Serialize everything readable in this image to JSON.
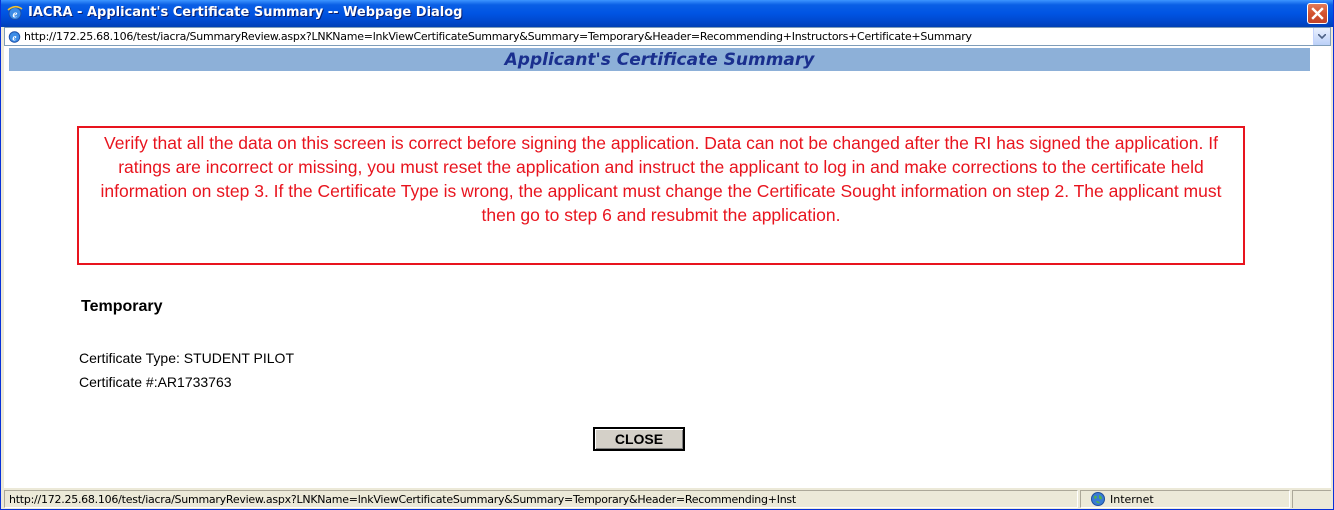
{
  "window": {
    "title": "IACRA - Applicant's Certificate Summary -- Webpage Dialog",
    "close_icon": "close-icon",
    "app_icon": "ie-icon"
  },
  "address": {
    "url": "http://172.25.68.106/test/iacra/SummaryReview.aspx?LNKName=lnkViewCertificateSummary&Summary=Temporary&Header=Recommending+Instructors+Certificate+Summary"
  },
  "page": {
    "title": "Applicant's Certificate Summary",
    "warning": "Verify that all the data on this screen is correct before signing the application. Data can not be changed after the RI has signed the application. If ratings are incorrect or missing, you must reset the application and instruct the applicant to log in and make corrections to the certificate held information on step 3. If the Certificate Type is wrong, the applicant must change the Certificate Sought information on step 2. The applicant must then go to step 6 and resubmit the application.",
    "section_heading": "Temporary",
    "certificate_type_line": "Certificate Type: STUDENT PILOT",
    "certificate_number_line": "Certificate #:AR1733763",
    "close_button": "CLOSE"
  },
  "statusbar": {
    "url": "http://172.25.68.106/test/iacra/SummaryReview.aspx?LNKName=lnkViewCertificateSummary&Summary=Temporary&Header=Recommending+Inst",
    "zone": "Internet"
  },
  "colors": {
    "warning": "#E8141E",
    "header_band": "#8DB0D8",
    "title_text": "#1A2F8E",
    "titlebar": "#0054E3"
  }
}
